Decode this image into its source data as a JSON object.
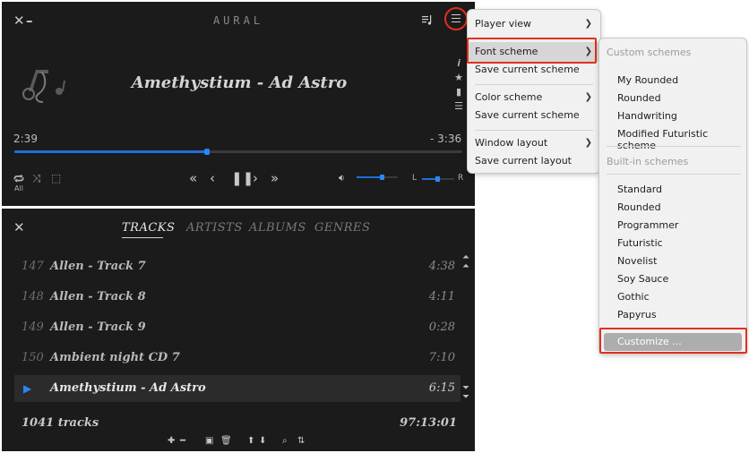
{
  "player": {
    "app_title": "AURAL",
    "track_title": "Amethystium - Ad Astro",
    "time_elapsed": "2:39",
    "time_remaining": "- 3:36",
    "seek_progress": 0.43,
    "repeat_label": "All",
    "volume_level": 0.62,
    "balance_level": 0.5,
    "balance_left_label": "L",
    "balance_right_label": "R"
  },
  "playlist": {
    "tabs": [
      {
        "label": "TRACKS",
        "active": true
      },
      {
        "label": "ARTISTS",
        "active": false
      },
      {
        "label": "ALBUMS",
        "active": false
      },
      {
        "label": "GENRES",
        "active": false
      }
    ],
    "rows": [
      {
        "num": "147",
        "title": "Allen - Track 7",
        "duration": "4:38",
        "playing": false
      },
      {
        "num": "148",
        "title": "Allen - Track 8",
        "duration": "4:11",
        "playing": false
      },
      {
        "num": "149",
        "title": "Allen - Track 9",
        "duration": "0:28",
        "playing": false
      },
      {
        "num": "150",
        "title": "Ambient night CD 7",
        "duration": "7:10",
        "playing": false
      },
      {
        "num": "",
        "title": "Amethystium - Ad Astro",
        "duration": "6:15",
        "playing": true
      }
    ],
    "track_count": "1041 tracks",
    "total_duration": "97:13:01"
  },
  "menu": {
    "items": [
      {
        "label": "Player view",
        "has_submenu": true
      },
      {
        "label": "Font scheme",
        "has_submenu": true
      },
      {
        "label": "Save current scheme",
        "has_submenu": false
      },
      {
        "label": "Color scheme",
        "has_submenu": true
      },
      {
        "label": "Save current scheme",
        "has_submenu": false
      },
      {
        "label": "Window layout",
        "has_submenu": true
      },
      {
        "label": "Save current layout",
        "has_submenu": false
      }
    ]
  },
  "submenu": {
    "custom_header": "Custom schemes",
    "custom_items": [
      "My Rounded",
      "Rounded",
      "Handwriting",
      "Modified Futuristic scheme"
    ],
    "builtin_header": "Built-in schemes",
    "builtin_items": [
      "Standard",
      "Rounded",
      "Programmer",
      "Futuristic",
      "Novelist",
      "Soy Sauce",
      "Gothic",
      "Papyrus"
    ],
    "customize_label": "Customize ..."
  },
  "colors": {
    "accent": "#1f6fd8",
    "highlight_box": "#e0301e",
    "window_bg": "#1b1b1b",
    "menu_bg": "#f1f1f1"
  }
}
